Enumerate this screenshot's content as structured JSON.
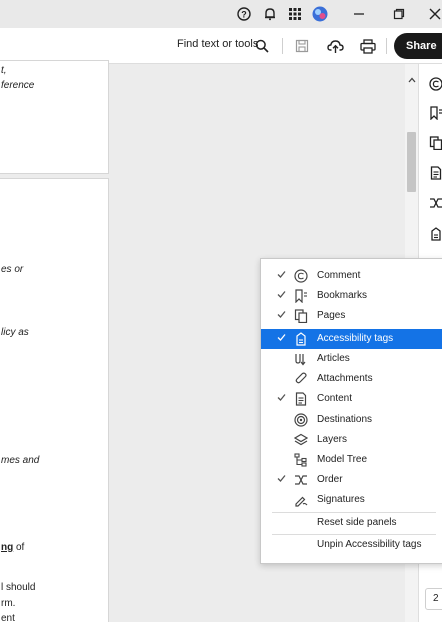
{
  "toolbar": {
    "find_label": "Find text or tools",
    "share_label": "Share"
  },
  "document": {
    "page1_fragments": [
      "t,",
      "ference"
    ],
    "page2_fragments": [
      "es or",
      "licy as",
      "mes and",
      "ng",
      " of",
      "l should",
      "rm.",
      "ent"
    ]
  },
  "page_number": "2",
  "menu": {
    "items": [
      {
        "label": "Comment",
        "checked": true,
        "icon": "comment-icon"
      },
      {
        "label": "Bookmarks",
        "checked": true,
        "icon": "bookmark-icon"
      },
      {
        "label": "Pages",
        "checked": true,
        "icon": "pages-icon"
      },
      {
        "label": "Accessibility tags",
        "checked": true,
        "icon": "accessibility-tags-icon",
        "highlighted": true
      },
      {
        "label": "Articles",
        "checked": false,
        "icon": "articles-icon"
      },
      {
        "label": "Attachments",
        "checked": false,
        "icon": "paperclip-icon"
      },
      {
        "label": "Content",
        "checked": true,
        "icon": "content-icon"
      },
      {
        "label": "Destinations",
        "checked": false,
        "icon": "destinations-icon"
      },
      {
        "label": "Layers",
        "checked": false,
        "icon": "layers-icon"
      },
      {
        "label": "Model Tree",
        "checked": false,
        "icon": "model-tree-icon"
      },
      {
        "label": "Order",
        "checked": true,
        "icon": "order-icon"
      },
      {
        "label": "Signatures",
        "checked": false,
        "icon": "signature-icon"
      }
    ],
    "reset_label": "Reset side panels",
    "unpin_label": "Unpin Accessibility tags"
  },
  "colors": {
    "highlight": "#1473e6",
    "share_bg": "#1a1a1a"
  }
}
